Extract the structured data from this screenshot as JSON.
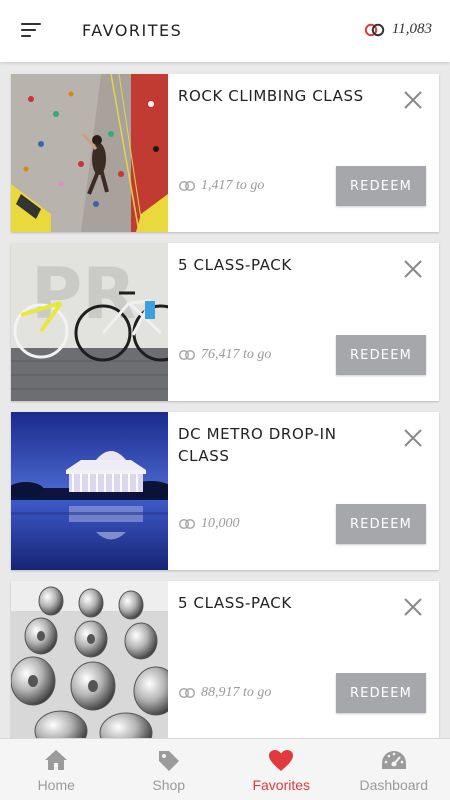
{
  "header": {
    "title": "Favorites",
    "points": "11,083"
  },
  "colors": {
    "accent": "#e03a3e",
    "redeem_button": "#a5a7aa",
    "inactive_tab": "#9b9b9b"
  },
  "cards": [
    {
      "title": "Rock Climbing Class",
      "points_text": "1,417 to go",
      "button": "Redeem",
      "image": "rock-climbing-wall"
    },
    {
      "title": "5 Class-Pack",
      "points_text": "76,417 to go",
      "button": "Redeem",
      "image": "bicycles-against-wall"
    },
    {
      "title": "DC Metro Drop-In Class",
      "points_text": "10,000",
      "button": "Redeem",
      "image": "jefferson-memorial-night"
    },
    {
      "title": "5 Class-Pack",
      "points_text": "88,917 to go",
      "button": "Redeem",
      "image": "dumbbell-rack"
    }
  ],
  "tabs": [
    {
      "label": "Home",
      "icon": "home-icon",
      "active": false
    },
    {
      "label": "Shop",
      "icon": "tag-icon",
      "active": false
    },
    {
      "label": "Favorites",
      "icon": "heart-icon",
      "active": true
    },
    {
      "label": "Dashboard",
      "icon": "gauge-icon",
      "active": false
    }
  ]
}
